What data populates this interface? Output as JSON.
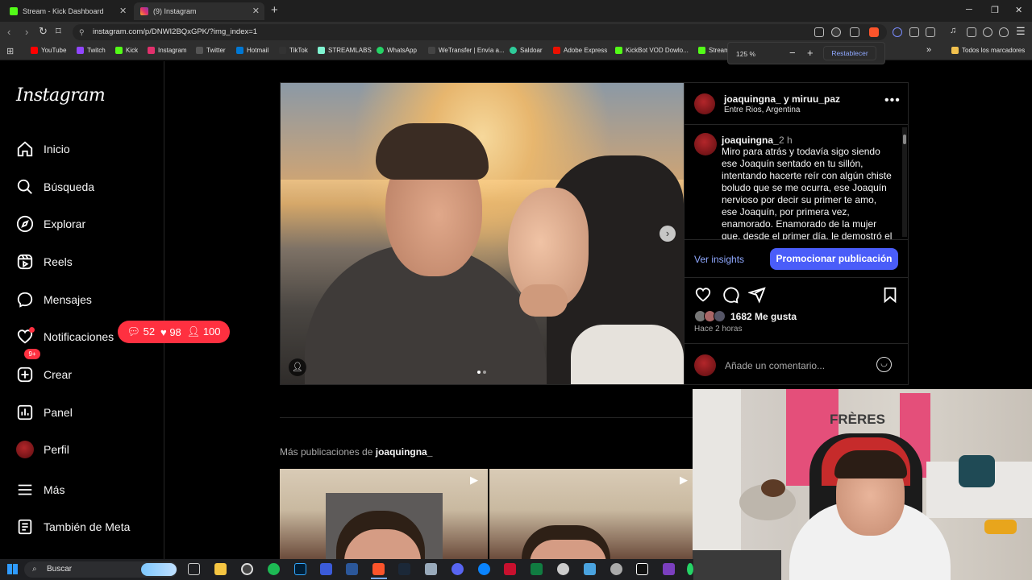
{
  "browser": {
    "tabs": [
      {
        "title": "Stream - Kick Dashboard",
        "favicon": "kick-icon",
        "color": "#53fc18"
      },
      {
        "title": "(9) Instagram",
        "favicon": "instagram-icon",
        "color": "#e1306c"
      }
    ],
    "new_tab": "+",
    "url": "instagram.com/p/DNWI2BQxGPK/?img_index=1",
    "zoom": {
      "level": "125 %",
      "minus": "−",
      "plus": "+",
      "reset": "Restablecer"
    },
    "bookmarks": [
      {
        "label": "YouTube",
        "color": "#ff0000"
      },
      {
        "label": "Twitch",
        "color": "#9146ff"
      },
      {
        "label": "Kick",
        "color": "#53fc18"
      },
      {
        "label": "Instagram",
        "color": "#e1306c"
      },
      {
        "label": "Twitter",
        "color": "#ffffff"
      },
      {
        "label": "Hotmail",
        "color": "#0078d4"
      },
      {
        "label": "TikTok",
        "color": "#ffffff"
      },
      {
        "label": "STREAMLABS",
        "color": "#80f5d2"
      },
      {
        "label": "WhatsApp",
        "color": "#25d366"
      },
      {
        "label": "WeTransfer | Envía a...",
        "color": "#cccccc"
      },
      {
        "label": "Saldoar",
        "color": "#2ecc9a"
      },
      {
        "label": "Adobe Express",
        "color": "#eb1000"
      },
      {
        "label": "KickBot VOD Dowlo...",
        "color": "#53fc18"
      },
      {
        "label": "Stream",
        "color": "#53fc18"
      }
    ],
    "bookmarks_more": "»",
    "all_bookmarks": "Todos los marcadores"
  },
  "sidebar": {
    "logo": "Instagram",
    "items": [
      {
        "label": "Inicio",
        "icon": "home-icon"
      },
      {
        "label": "Búsqueda",
        "icon": "search-icon"
      },
      {
        "label": "Explorar",
        "icon": "compass-icon"
      },
      {
        "label": "Reels",
        "icon": "reels-icon"
      },
      {
        "label": "Mensajes",
        "icon": "messenger-icon"
      },
      {
        "label": "Notificaciones",
        "icon": "heart-icon"
      },
      {
        "label": "Crear",
        "icon": "plus-square-icon"
      },
      {
        "label": "Panel",
        "icon": "chart-icon"
      },
      {
        "label": "Perfil",
        "icon": "avatar"
      },
      {
        "label": "Más",
        "icon": "menu-icon"
      },
      {
        "label": "También de Meta",
        "icon": "threads-icon"
      }
    ],
    "messages_badge": "9+",
    "notifications": {
      "comments": "52",
      "likes": "98",
      "followers": "100"
    }
  },
  "post": {
    "author": "joaquingna_ y miruu_paz",
    "location": "Entre Rios, Argentina",
    "caption_user": "joaquingna_",
    "caption_time": "2 h",
    "caption_text": "Miro para atrás y todavía sigo siendo ese Joaquín sentado en tu sillón, intentando hacerte reír con algún chiste boludo que se me ocurra, ese Joaquín nervioso por decir su primer te amo, ese Joaquín, por primera vez, enamorado. Enamorado de la mujer que, desde el primer día, le demostró el amor más",
    "insights": "Ver insights",
    "promote": "Promocionar publicación",
    "likes": "1682 Me gusta",
    "time_ago": "Hace 2 horas",
    "comment_placeholder": "Añade un comentario..."
  },
  "more_posts": {
    "prefix": "Más publicaciones de ",
    "user": "joaquingna_"
  },
  "webcam": {
    "shirt_text": "FRÈRES"
  },
  "taskbar": {
    "search": "Buscar"
  }
}
